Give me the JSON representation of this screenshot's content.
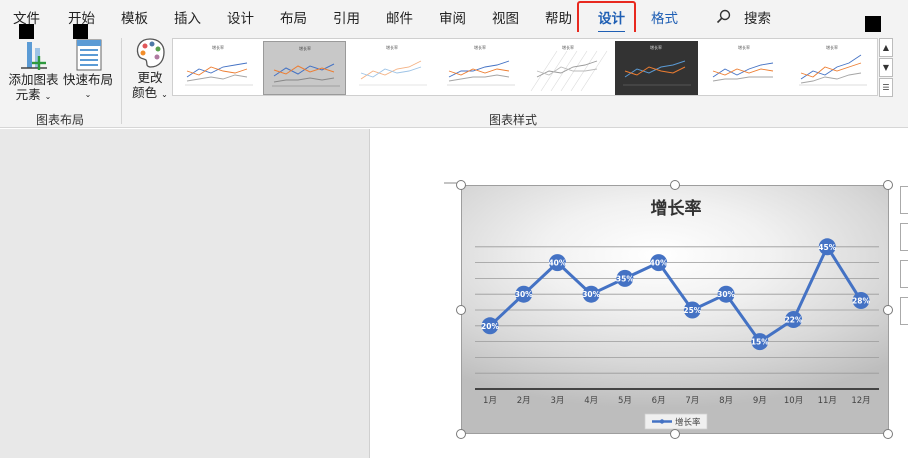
{
  "tabs": [
    {
      "label": "文件"
    },
    {
      "label": "开始"
    },
    {
      "label": "模板"
    },
    {
      "label": "插入"
    },
    {
      "label": "设计"
    },
    {
      "label": "布局"
    },
    {
      "label": "引用"
    },
    {
      "label": "邮件"
    },
    {
      "label": "审阅"
    },
    {
      "label": "视图"
    },
    {
      "label": "帮助"
    },
    {
      "label": "设计"
    },
    {
      "label": "格式"
    }
  ],
  "search_label": "搜索",
  "ribbon": {
    "add_element_line1": "添加图表",
    "add_element_line2": "元素",
    "quick_layout": "快速布局",
    "change_color_line1": "更改",
    "change_color_line2": "颜色",
    "group_layout": "图表布局",
    "group_styles": "图表样式",
    "thumb_title": "增长率"
  },
  "chart_data": {
    "type": "line",
    "title": "增长率",
    "categories": [
      "1月",
      "2月",
      "3月",
      "4月",
      "5月",
      "6月",
      "7月",
      "8月",
      "9月",
      "10月",
      "11月",
      "12月"
    ],
    "series": [
      {
        "name": "增长率",
        "values": [
          20,
          30,
          40,
          30,
          35,
          40,
          25,
          30,
          15,
          22,
          45,
          28
        ],
        "color": "#4472c4"
      }
    ],
    "data_labels": [
      "20%",
      "30%",
      "40%",
      "30%",
      "35%",
      "40%",
      "25%",
      "30%",
      "15%",
      "22%",
      "45%",
      "28%"
    ],
    "ylim": [
      0,
      50
    ],
    "grid": true,
    "legend": "bottom"
  }
}
